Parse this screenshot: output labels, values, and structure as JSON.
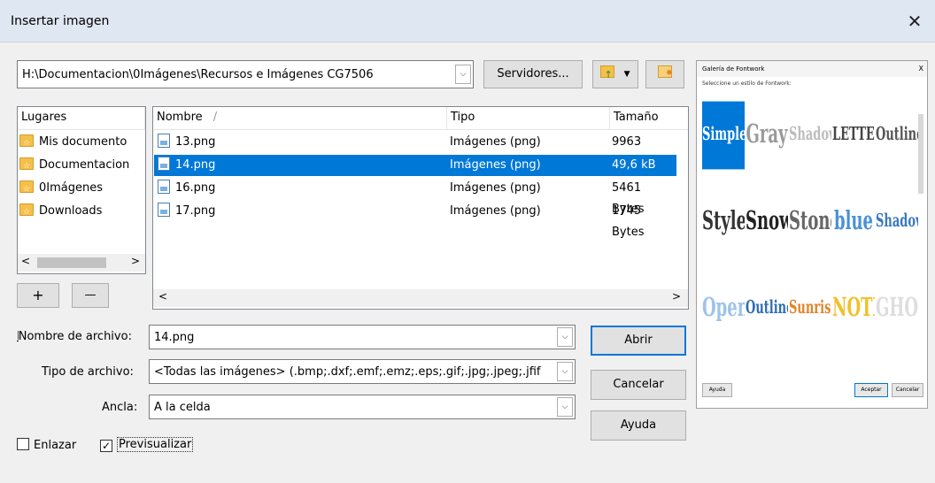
{
  "dialog": {
    "title": "Insertar imagen",
    "close_glyph": "✕"
  },
  "path": {
    "value": "H:\\Documentacion\\0Imágenes\\Recursos e Imágenes CG7506"
  },
  "toolbar": {
    "servers_label": "Servidores...",
    "up_icon": "folder-up-icon",
    "new_folder_icon": "new-folder-icon"
  },
  "places": {
    "header": "Lugares",
    "items": [
      {
        "label": "Mis documento"
      },
      {
        "label": "Documentacion"
      },
      {
        "label": "0Imágenes"
      },
      {
        "label": "Downloads"
      }
    ],
    "add_label": "+",
    "remove_label": "—"
  },
  "files": {
    "columns": {
      "name": "Nombre",
      "type": "Tipo",
      "size": "Tamaño",
      "sort_glyph": "/"
    },
    "rows": [
      {
        "name": "13.png",
        "type": "Imágenes (png)",
        "size": "9963 Bytes"
      },
      {
        "name": "14.png",
        "type": "Imágenes (png)",
        "size": "49,6 kB"
      },
      {
        "name": "16.png",
        "type": "Imágenes (png)",
        "size": "5461 Bytes"
      },
      {
        "name": "17.png",
        "type": "Imágenes (png)",
        "size": "1745 Bytes"
      }
    ],
    "selected_index": 1
  },
  "form": {
    "filename_label": "Nombre de archivo:",
    "filename_value": "14.png",
    "filetype_label": "Tipo de archivo:",
    "filetype_value": "<Todas las imágenes> (.bmp;.dxf;.emf;.emz;.eps;.gif;.jpg;.jpeg;.jfif",
    "anchor_label": "Ancla:",
    "anchor_value": "A la celda",
    "link_label": "Enlazar",
    "link_checked": false,
    "preview_label": "Previsualizar",
    "preview_checked": true
  },
  "buttons": {
    "open": "Abrir",
    "cancel": "Cancelar",
    "help": "Ayuda"
  },
  "preview": {
    "title": "Galería de Fontwork",
    "close": "X",
    "subtitle": "Seleccione un estilo de Fontwork:",
    "styles": [
      {
        "text": "Simple",
        "color": "#ffffff",
        "bg": "#0078d7"
      },
      {
        "text": "Gray",
        "color": "#9a9a9a",
        "bg": "#ffffff"
      },
      {
        "text": "Shadow",
        "color": "#bdbdbd",
        "bg": "#ffffff"
      },
      {
        "text": "LETTER",
        "color": "#444444",
        "bg": "#ffffff"
      },
      {
        "text": "Outline",
        "color": "#555555",
        "bg": "#ffffff"
      },
      {
        "text": "Style",
        "color": "#333333",
        "bg": "#ffffff"
      },
      {
        "text": "Snow",
        "color": "#222222",
        "bg": "#ffffff"
      },
      {
        "text": "Stone",
        "color": "#666666",
        "bg": "#ffffff"
      },
      {
        "text": "blue",
        "color": "#4a90d9",
        "bg": "#ffffff"
      },
      {
        "text": "Shadow",
        "color": "#3a78c2",
        "bg": "#ffffff"
      },
      {
        "text": "Open",
        "color": "#9ec3ea",
        "bg": "#ffffff"
      },
      {
        "text": "Outline",
        "color": "#2e6db4",
        "bg": "#ffffff"
      },
      {
        "text": "Sunrise",
        "color": "#e0852a",
        "bg": "#ffffff"
      },
      {
        "text": "NOTE",
        "color": "#f2c029",
        "bg": "#ffffff"
      },
      {
        "text": "GHOST",
        "color": "#dddddd",
        "bg": "#ffffff"
      }
    ],
    "help_btn": "Ayuda",
    "accept_btn": "Aceptar",
    "cancel_btn": "Cancelar"
  }
}
